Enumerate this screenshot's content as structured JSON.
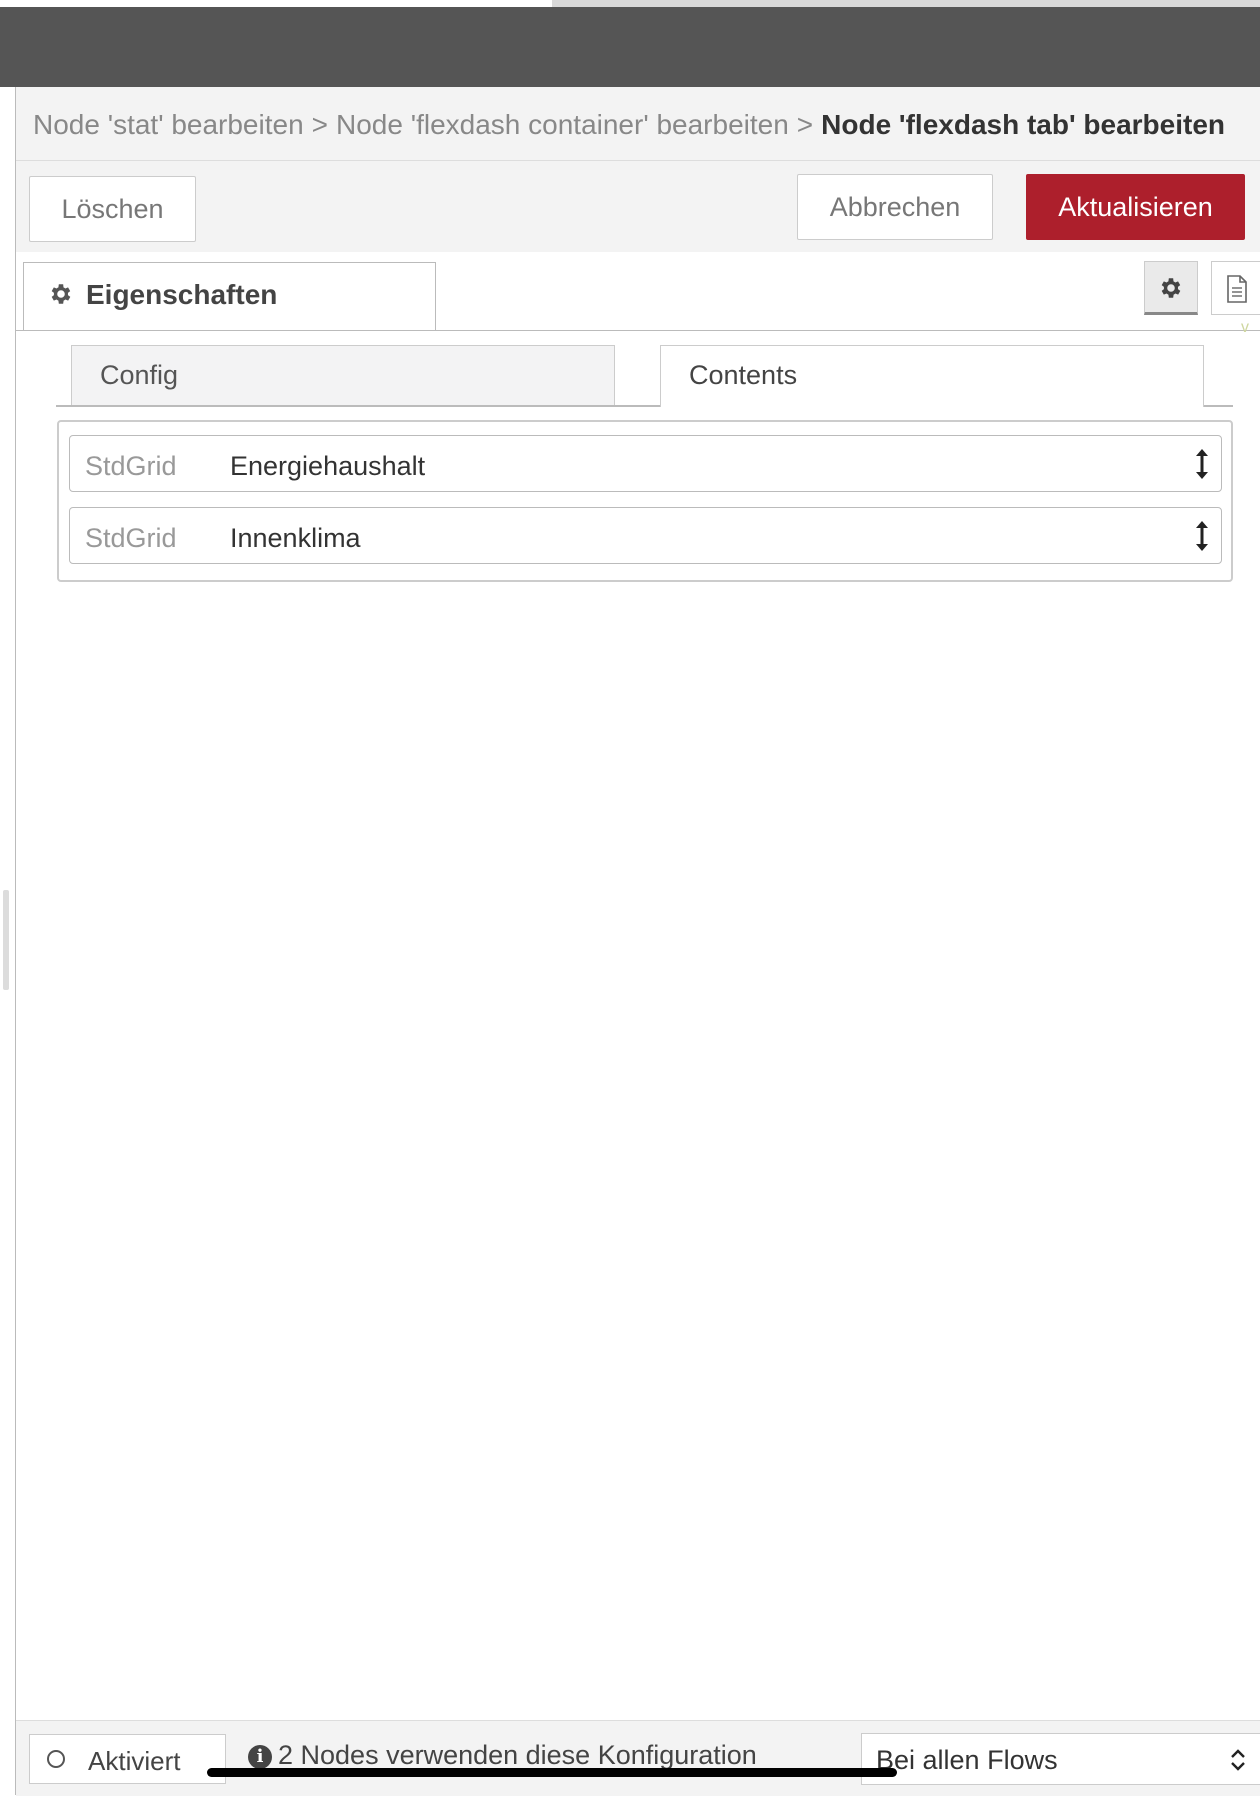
{
  "breadcrumb": {
    "items": [
      "Node 'stat' bearbeiten",
      "Node 'flexdash container' bearbeiten"
    ],
    "separator": ">",
    "current": "Node 'flexdash tab' bearbeiten"
  },
  "toolbar": {
    "delete_label": "Löschen",
    "cancel_label": "Abbrechen",
    "update_label": "Aktualisieren",
    "accent_color": "#ad1f2c"
  },
  "tabs": {
    "properties_label": "Eigenschaften",
    "properties_icon": "gear-icon",
    "side_icons": [
      "gear-icon",
      "document-icon"
    ]
  },
  "subtabs": {
    "items": [
      {
        "label": "Config",
        "active": false
      },
      {
        "label": "Contents",
        "active": true
      }
    ]
  },
  "contents": {
    "rows": [
      {
        "type": "StdGrid",
        "name": "Energiehaushalt"
      },
      {
        "type": "StdGrid",
        "name": "Innenklima"
      }
    ]
  },
  "footer": {
    "enabled_label": "Aktiviert",
    "info_text": "2 Nodes verwenden diese Konfiguration",
    "scope_value": "Bei allen Flows"
  }
}
